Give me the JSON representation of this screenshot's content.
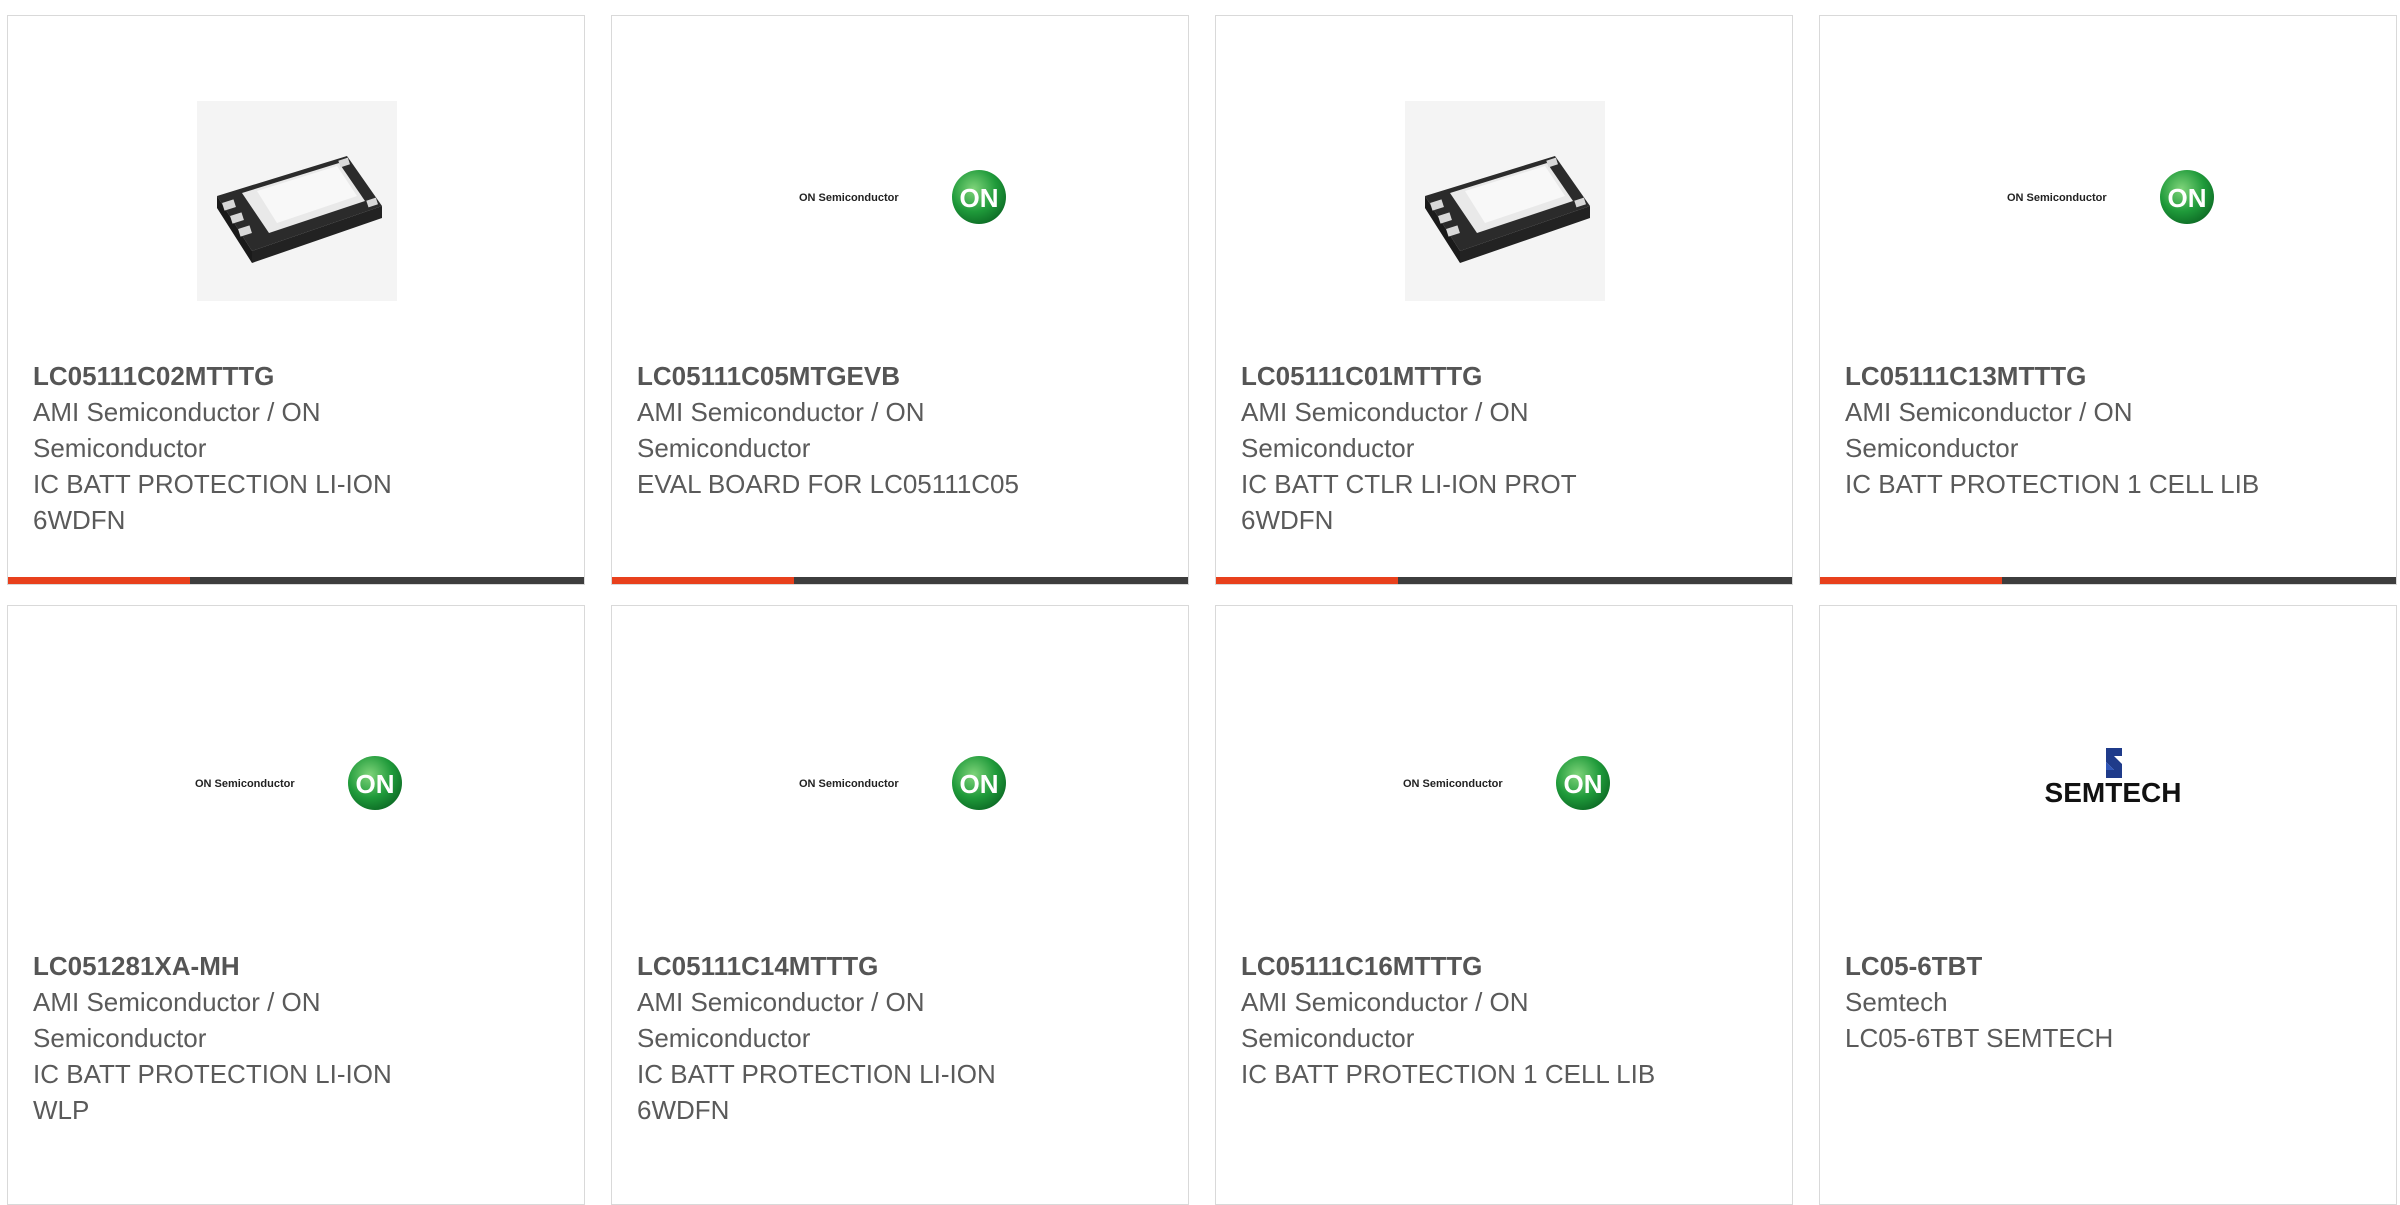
{
  "colors": {
    "accent": "#e8401c",
    "bar": "#3d3d3d",
    "on_green": "#1f9a3a",
    "border": "#d9d9d9"
  },
  "cards": [
    {
      "part": "LC05111C02MTTTG",
      "manufacturer": "AMI Semiconductor / ON Semiconductor",
      "description": "IC BATT PROTECTION LI-ION 6WDFN",
      "image": "chip-package-image"
    },
    {
      "part": "LC05111C05MTGEVB",
      "manufacturer": "AMI Semiconductor / ON Semiconductor",
      "description": "EVAL BOARD FOR LC05111C05",
      "image": "on-semiconductor-logo",
      "logo_text": "ON Semiconductor",
      "badge_text": "ON"
    },
    {
      "part": "LC05111C01MTTTG",
      "manufacturer": "AMI Semiconductor / ON Semiconductor",
      "description": "IC BATT CTLR LI-ION PROT 6WDFN",
      "image": "chip-package-image"
    },
    {
      "part": "LC05111C13MTTTG",
      "manufacturer": "AMI Semiconductor / ON Semiconductor",
      "description": "IC BATT PROTECTION 1 CELL LIB",
      "image": "on-semiconductor-logo",
      "logo_text": "ON Semiconductor",
      "badge_text": "ON"
    },
    {
      "part": "LC051281XA-MH",
      "manufacturer": "AMI Semiconductor / ON Semiconductor",
      "description": "IC BATT PROTECTION LI-ION WLP",
      "image": "on-semiconductor-logo",
      "logo_text": "ON Semiconductor",
      "badge_text": "ON"
    },
    {
      "part": "LC05111C14MTTTG",
      "manufacturer": "AMI Semiconductor / ON Semiconductor",
      "description": "IC BATT PROTECTION LI-ION 6WDFN",
      "image": "on-semiconductor-logo",
      "logo_text": "ON Semiconductor",
      "badge_text": "ON"
    },
    {
      "part": "LC05111C16MTTTG",
      "manufacturer": "AMI Semiconductor / ON Semiconductor",
      "description": "IC BATT PROTECTION 1 CELL LIB",
      "image": "on-semiconductor-logo",
      "logo_text": "ON Semiconductor",
      "badge_text": "ON"
    },
    {
      "part": "LC05-6TBT",
      "manufacturer": "Semtech",
      "description": "LC05-6TBT SEMTECH",
      "image": "semtech-logo",
      "logo_text": "SEMTECH"
    }
  ]
}
